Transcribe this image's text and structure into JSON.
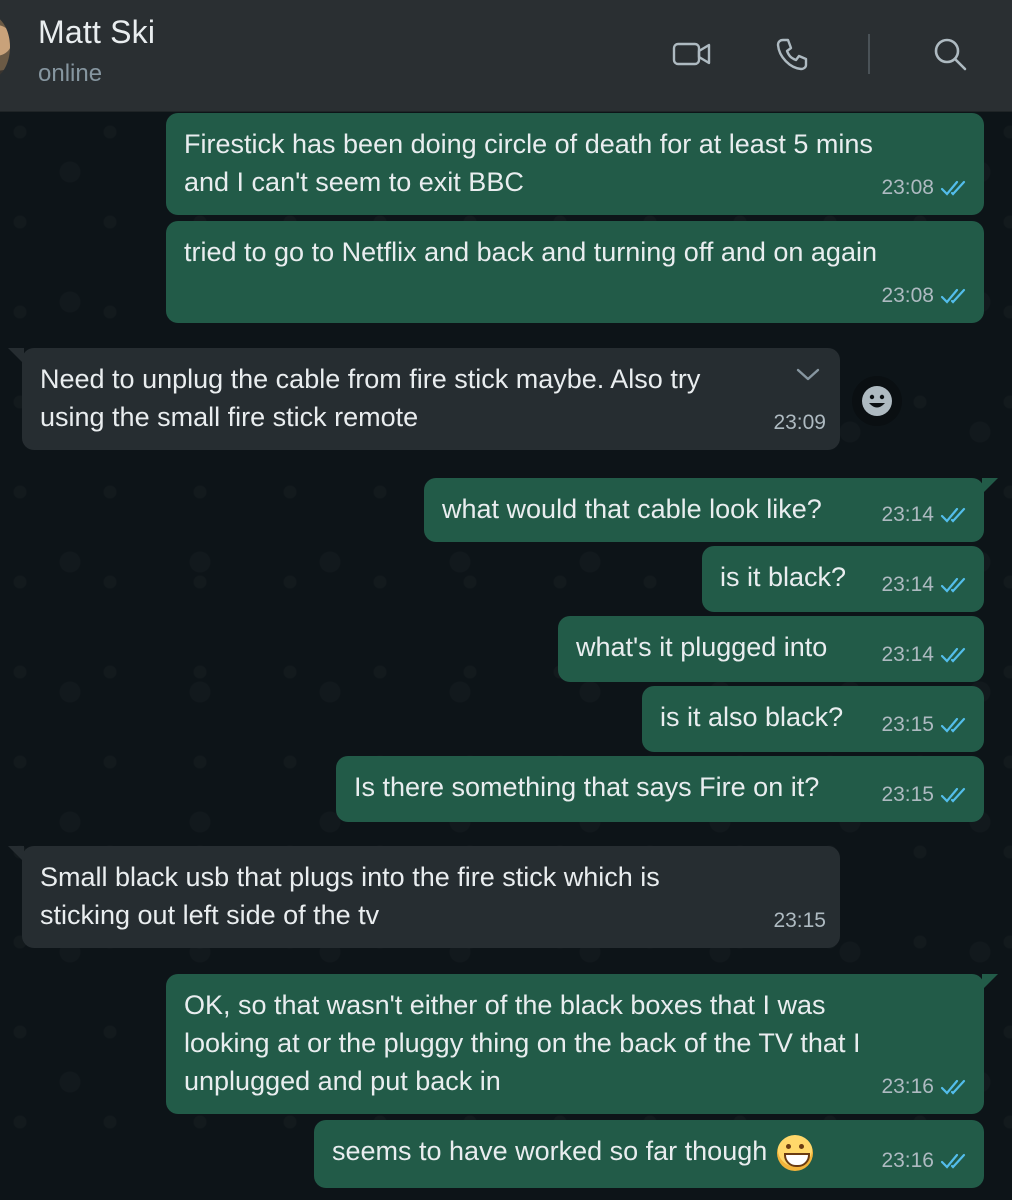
{
  "header": {
    "name": "Matt Ski",
    "status": "online",
    "icons": [
      "video-call-icon",
      "voice-call-icon",
      "search-icon"
    ]
  },
  "messages": [
    {
      "dir": "out",
      "text": "Firestick has been doing circle of death for at least 5 mins\nand I can't seem to exit BBC",
      "time": "23:08",
      "read": true
    },
    {
      "dir": "out",
      "text": "tried to go to Netflix and back and turning off and on again",
      "time": "23:08",
      "read": true
    },
    {
      "dir": "in",
      "text": "Need to unplug the cable from fire stick maybe. Also try\nusing the small fire stick remote",
      "time": "23:09"
    },
    {
      "dir": "out",
      "text": "what would that cable look like?",
      "time": "23:14",
      "read": true
    },
    {
      "dir": "out",
      "text": "is it black?",
      "time": "23:14",
      "read": true
    },
    {
      "dir": "out",
      "text": "what's it plugged into",
      "time": "23:14",
      "read": true
    },
    {
      "dir": "out",
      "text": "is it also black?",
      "time": "23:15",
      "read": true
    },
    {
      "dir": "out",
      "text": "Is there something that says Fire on it?",
      "time": "23:15",
      "read": true
    },
    {
      "dir": "in",
      "text": "Small black usb that plugs into the fire stick which is\nsticking out left side of the tv",
      "time": "23:15"
    },
    {
      "dir": "out",
      "text": "OK, so that wasn't either of the black boxes that I was\nlooking at or the pluggy thing on the back of the TV that I\nunplugged and put back in",
      "time": "23:16",
      "read": true
    },
    {
      "dir": "out",
      "text": "seems to have worked so far though",
      "emoji": "grinning-face",
      "time": "23:16",
      "read": true
    }
  ],
  "colors": {
    "outgoing_bubble": "#225b48",
    "incoming_bubble": "#262d31",
    "background": "#0d1418",
    "header": "#2a2f32",
    "read_ticks": "#53bdeb"
  }
}
